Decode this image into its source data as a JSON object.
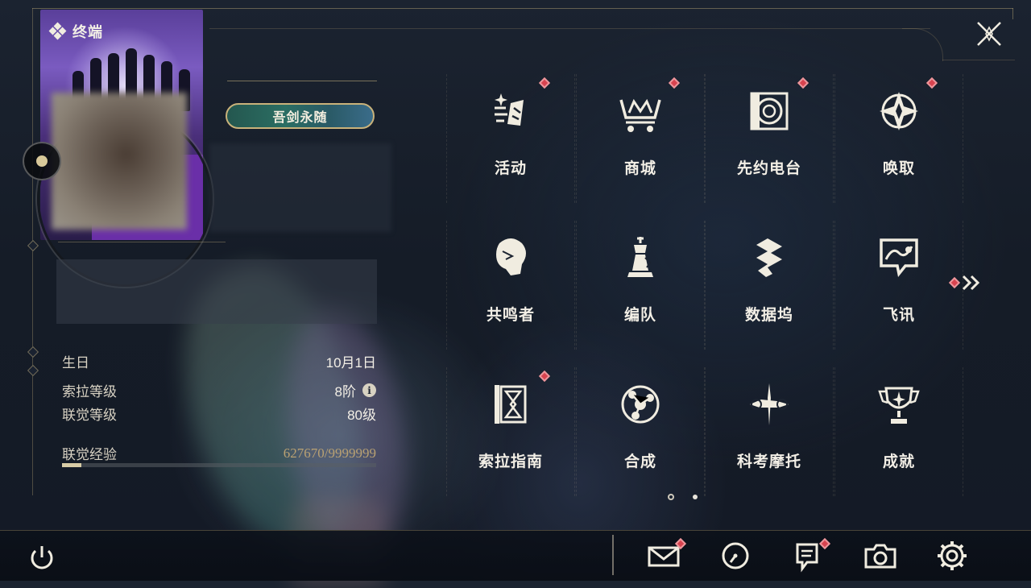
{
  "terminal": {
    "title": "终端"
  },
  "profile": {
    "title_badge": "吾剑永随",
    "stats": [
      {
        "label": "生日",
        "value": "10月1日"
      },
      {
        "label": "索拉等级",
        "value": "8阶"
      },
      {
        "label": "联觉等级",
        "value": "80级"
      }
    ],
    "exp": {
      "label": "联觉经验",
      "value": "627670/9999999",
      "progress": 0.0628
    }
  },
  "menu": {
    "items": [
      {
        "label": "活动",
        "icon": "fireworks-icon",
        "badge": true
      },
      {
        "label": "商城",
        "icon": "shop-cart-icon",
        "badge": true
      },
      {
        "label": "先约电台",
        "icon": "radio-icon",
        "badge": true
      },
      {
        "label": "唤取",
        "icon": "convene-icon",
        "badge": true
      },
      {
        "label": "共鸣者",
        "icon": "resonator-icon",
        "badge": false
      },
      {
        "label": "编队",
        "icon": "team-chess-icon",
        "badge": false
      },
      {
        "label": "数据坞",
        "icon": "databank-icon",
        "badge": false
      },
      {
        "label": "飞讯",
        "icon": "message-icon",
        "badge": false
      },
      {
        "label": "索拉指南",
        "icon": "guidebook-icon",
        "badge": true
      },
      {
        "label": "合成",
        "icon": "synthesis-icon",
        "badge": false
      },
      {
        "label": "科考摩托",
        "icon": "motorbike-icon",
        "badge": false
      },
      {
        "label": "成就",
        "icon": "trophy-icon",
        "badge": false
      }
    ],
    "page_indicator": {
      "current": 1,
      "total": 2
    }
  },
  "bottom_bar": {
    "icons": [
      "mail-icon",
      "clock-icon",
      "notice-icon",
      "camera-icon",
      "settings-icon"
    ],
    "badges": {
      "mail": true,
      "notice": true
    }
  },
  "colors": {
    "accent_gold": "#c9b27a",
    "badge_red": "#d8434f",
    "text_light": "#f3efe6"
  }
}
